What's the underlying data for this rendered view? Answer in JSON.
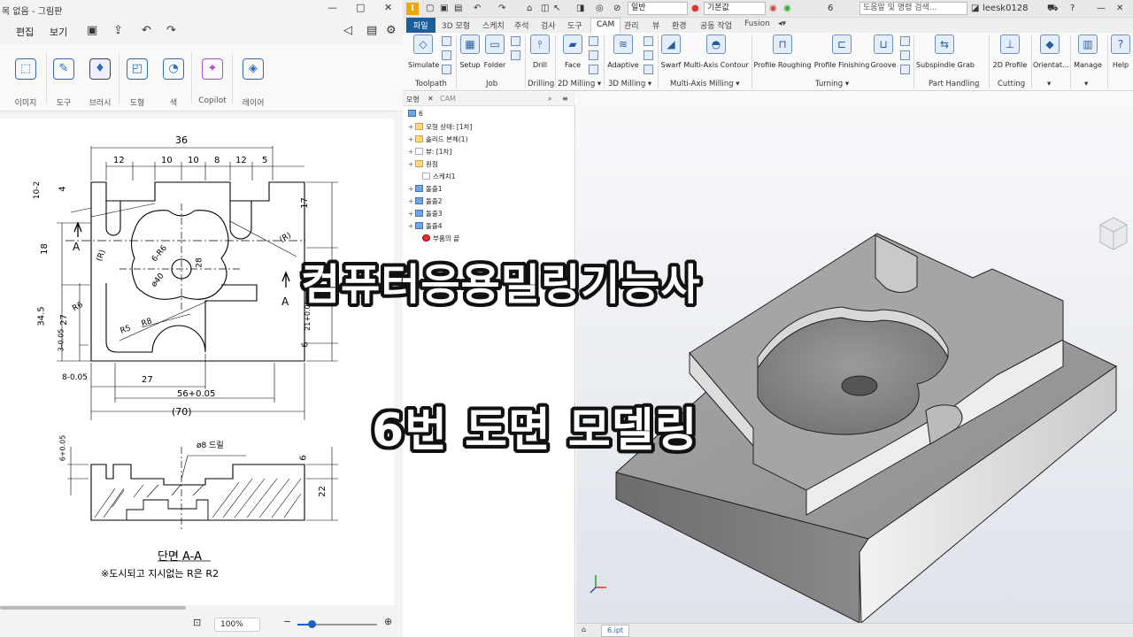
{
  "paint": {
    "title": "목 없음 - 그림판",
    "window_controls": [
      "—",
      "□",
      "✕"
    ],
    "menu": {
      "edit": "편집",
      "view": "보기"
    },
    "ribbon": [
      {
        "label": "이미지",
        "icon": "image-select-icon"
      },
      {
        "label": "도구",
        "icon": "tools-icon"
      },
      {
        "label": "브러시",
        "icon": "brush-icon"
      },
      {
        "label": "도형",
        "icon": "shapes-icon"
      },
      {
        "label": "색",
        "icon": "palette-icon"
      },
      {
        "label": "Copilot",
        "icon": "copilot-icon"
      },
      {
        "label": "레이어",
        "icon": "layers-icon"
      }
    ],
    "zoom": "100%",
    "drawing": {
      "dims": [
        "36",
        "12",
        "10",
        "10",
        "8",
        "12",
        "5",
        "17",
        "4",
        "18",
        "34.5",
        "27",
        "3-0.05",
        "8-0.05",
        "27",
        "56+0.05",
        "(70)",
        "6",
        "21+0.05",
        "6+0.05",
        "6",
        "22",
        "ø8 드릴",
        "ø40",
        "28",
        "6-R6",
        "R6",
        "R5",
        "R8",
        "(R)",
        "(R)",
        "A",
        "A",
        "10-2"
      ],
      "section_title": "단면 A-A",
      "note": "※도시되고 지시없는 R은 R2"
    }
  },
  "inventor": {
    "qat": {
      "dropdown1": "일반",
      "dropdown2": "기본값",
      "number": "6",
      "search": "도움말 및 명령 검색...",
      "user": "leesk0128"
    },
    "tabs": [
      "파일",
      "3D 모형",
      "스케치",
      "주석",
      "검사",
      "도구",
      "CAM",
      "관리",
      "뷰",
      "환경",
      "공동 작업",
      "Fusion"
    ],
    "ribbon_buttons": [
      "Simulate",
      "Setup",
      "Folder",
      "Drill",
      "Face",
      "Adaptive",
      "Swarf",
      "Multi-Axis Contour",
      "Profile Roughing",
      "Profile Finishing",
      "Groove",
      "Subspindle Grab",
      "2D Profile",
      "Orientat...",
      "Manage",
      "Help"
    ],
    "ribbon_panels": [
      "Toolpath",
      "Job",
      "Drilling",
      "2D Milling ▾",
      "3D Milling ▾",
      "Multi-Axis Milling ▾",
      "Turning ▾",
      "Part Handling",
      "Cutting",
      "▾",
      "▾"
    ],
    "browser_tabs": [
      "모형",
      "CAM"
    ],
    "tree": [
      "6",
      "모형 상태: [1차]",
      "솔리드 본체(1)",
      "뷰: [1차]",
      "원점",
      "스케치1",
      "돌출1",
      "돌출2",
      "돌출3",
      "돌출4",
      "부품의 끝"
    ],
    "doc_tab": "6.ipt"
  },
  "overlay": {
    "line1": "컴퓨터응용밀링기능사",
    "line2": "6번 도면 모델링"
  }
}
